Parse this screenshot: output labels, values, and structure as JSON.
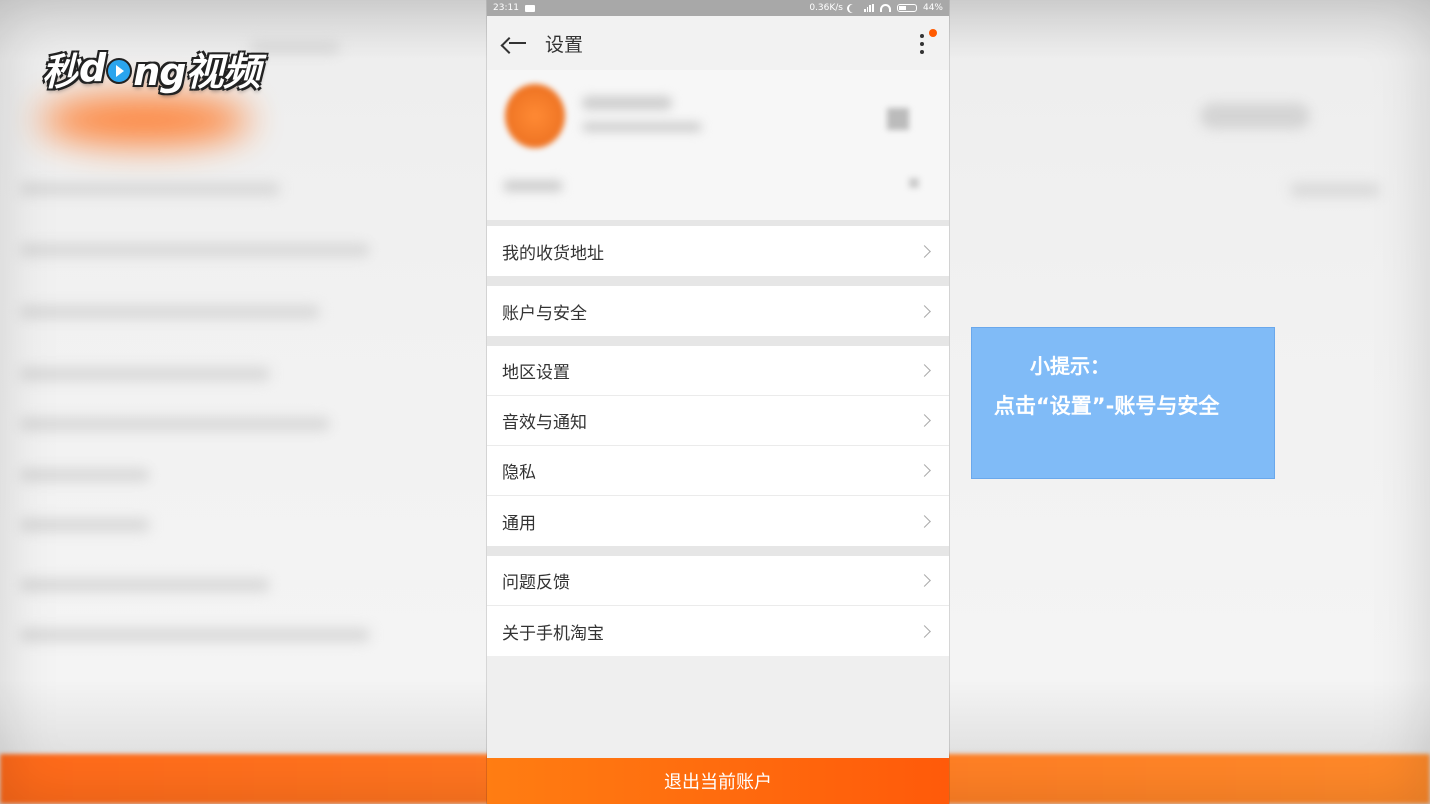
{
  "logo": {
    "prefix": "秒",
    "middle": "d",
    "suffix": "ng视频"
  },
  "statusbar": {
    "time": "23:11",
    "speed": "0.36K/s",
    "battery": "44%"
  },
  "appbar": {
    "title": "设置"
  },
  "settings": {
    "groups": [
      {
        "items": [
          {
            "label": "我的收货地址"
          }
        ]
      },
      {
        "items": [
          {
            "label": "账户与安全"
          }
        ]
      },
      {
        "items": [
          {
            "label": "地区设置"
          },
          {
            "label": "音效与通知"
          },
          {
            "label": "隐私"
          },
          {
            "label": "通用"
          }
        ]
      },
      {
        "items": [
          {
            "label": "问题反馈"
          },
          {
            "label": "关于手机淘宝"
          }
        ]
      }
    ]
  },
  "logout_label": "退出当前账户",
  "tip": {
    "title": "小提示：",
    "body": "点击“设置”-账号与安全"
  },
  "colors": {
    "accent": "#ff6a0a",
    "tip_bg": "#80bbf7"
  }
}
